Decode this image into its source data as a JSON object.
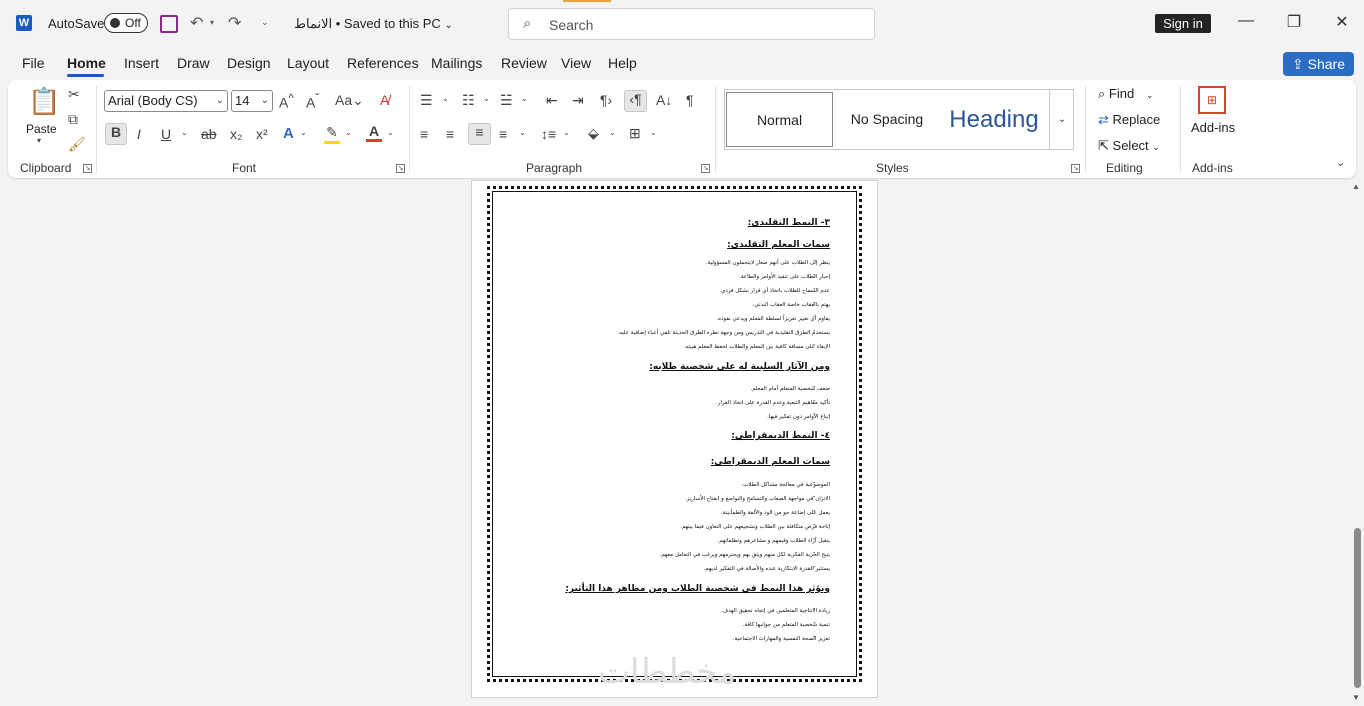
{
  "titlebar": {
    "app_logo": "W",
    "autosave_label": "AutoSave",
    "autosave_state": "Off",
    "doc_title": "الانماط • Saved to this PC",
    "search_placeholder": "Search",
    "signin_label": "Sign in",
    "icons": [
      "save-icon",
      "undo-icon",
      "redo-icon",
      "customize-qat-icon",
      "search-icon",
      "minimize-icon",
      "restore-icon",
      "close-icon"
    ]
  },
  "menu": {
    "items": [
      "File",
      "Home",
      "Insert",
      "Draw",
      "Design",
      "Layout",
      "References",
      "Mailings",
      "Review",
      "View",
      "Help"
    ],
    "active": "Home",
    "share_label": "Share"
  },
  "ribbon": {
    "clipboard": {
      "paste_label": "Paste",
      "group_label": "Clipboard"
    },
    "font": {
      "font_name": "Arial (Body CS)",
      "font_size": "14",
      "group_label": "Font",
      "font_color": "#e03c31",
      "highlight_color": "#ffd700"
    },
    "paragraph": {
      "group_label": "Paragraph"
    },
    "styles": {
      "normal": "Normal",
      "no_spacing": "No Spacing",
      "heading": "Heading",
      "group_label": "Styles"
    },
    "editing": {
      "find": "Find",
      "replace": "Replace",
      "select": "Select",
      "group_label": "Editing"
    },
    "addins": {
      "label": "Add-ins",
      "group_label": "Add-ins"
    }
  },
  "document": {
    "h1": "٣- النمط التقليدي:",
    "h2": "سمات المعلم التقليدي:",
    "list1": [
      "ينظر إلى الطلاب على أنهم صغار لايتحملون المسؤولية.",
      "إجبار الطلاب على تنفيذ الأوامر والطاعة.",
      "عدم السماح للطلاب باتخاذ أي قرار بشكل فردي.",
      "يهتم بالعقاب خاصة العقاب البدني.",
      "يقاوم أي تغيير تعزيزاً لسلطة المعلم ويدعي نفوذه.",
      "يستخدم الطرق التقليدية في التدريس ومن وجهة نظره الطرق الحديثة تلقي أعباء إضافية عليه.",
      "الإبقاء على مسافة كافية بين المعلم والطلاب لحفظ المعلم هيبته."
    ],
    "h3": "ومن الآثار السلبية له على شخصية طلابه:",
    "list2": [
      "ضعف شخصية المتعلم أمام المعلم.",
      "تأكيد مفاهيم التبعية وعدم القدرة على اتخاذ القرار.",
      "إتباع الأوامر دون تفكير فيها."
    ],
    "h4": "٤- النمط الديمقراطي:",
    "h5": "سمات المعلم الديمقراطي:",
    "list3": [
      "الموضوعية في معالجة مشاكل الطلاب.",
      "الاتزان في مواجهة الصعاب والتسامح والتواضع و انفتاح الأساريز.",
      "يعمل على إضاعة جو من الود والألفة والطمأنينة.",
      "إتاحة فرص متكافئة بين الطلاب وتشجيعهم على التعاون فيما بينهم.",
      "يتقبل آراء الطلاب وقيمهم و مشاعرهم وتطلعاتهم.",
      "يتيح الحرية الفكرية لكل منهم ويثق بهم ويحترمهم ويرغب في التعامل معهم.",
      "يستثير القدرة الابتكارية عنده والأصالة في التفكير لديهم."
    ],
    "h6": "ويؤثر هذا النمط في شخصية الطلاب ومن مظاهر هذا التأثير:",
    "list4": [
      "زيادة الانتاجية المتعلمين في إتجاه تحقيق الهدف.",
      "تنمية شخصية المتعلم من جوانبها كافة.",
      "تعزيز الصحة النفسية والمهارات الاجتماعية."
    ],
    "watermark": "مخططات"
  }
}
